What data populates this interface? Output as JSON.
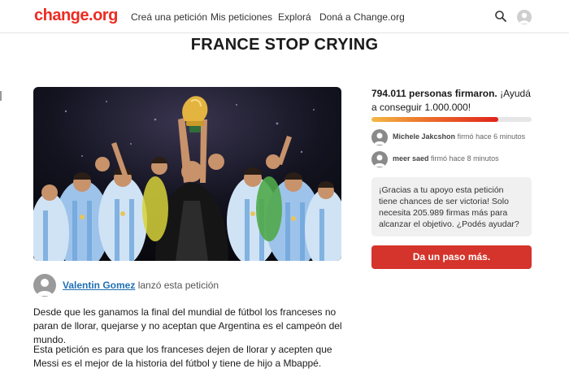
{
  "nav": {
    "logo": "change.org",
    "links": [
      "Creá una petición",
      "Mis peticiones",
      "Explorá",
      "Doná a Change.org"
    ],
    "search_icon": "search-icon",
    "avatar_icon": "user-avatar-icon"
  },
  "petition": {
    "title": "FRANCE STOP CRYING",
    "image_icon": "team-celebration-photo",
    "starter_name": "Valentin Gomez",
    "starter_suffix": "lanzó esta petición",
    "description": [
      "Desde que les ganamos la final del mundial de fútbol los franceses no paran de llorar, quejarse y no aceptan que Argentina es el campeón del mundo.",
      "Esta petición es para que los franceses dejen de llorar y acepten que Messi es el mejor de la historia del fútbol y tiene de hijo a Mbappé."
    ]
  },
  "sidebar": {
    "count_bold": "794.011 personas firmaron.",
    "count_rest": "¡Ayudá a conseguir 1.000.000!",
    "progress_fraction": 0.794,
    "signers": [
      {
        "name": "Michele Jakcshon",
        "action": "firmó hace 6 minutos"
      },
      {
        "name": "meer saed",
        "action": "firmó hace 8 minutos"
      }
    ],
    "callout": "¡Gracias a tu apoyo esta petición tiene chances de ser victoria! Solo necesita 205.989 firmas más para alcanzar el objetivo. ¿Podés ayudar?",
    "cta_label": "Da un paso más."
  },
  "colors": {
    "brand": "#ec2c22",
    "cta": "#d4342b",
    "link": "#1f6fb5"
  }
}
